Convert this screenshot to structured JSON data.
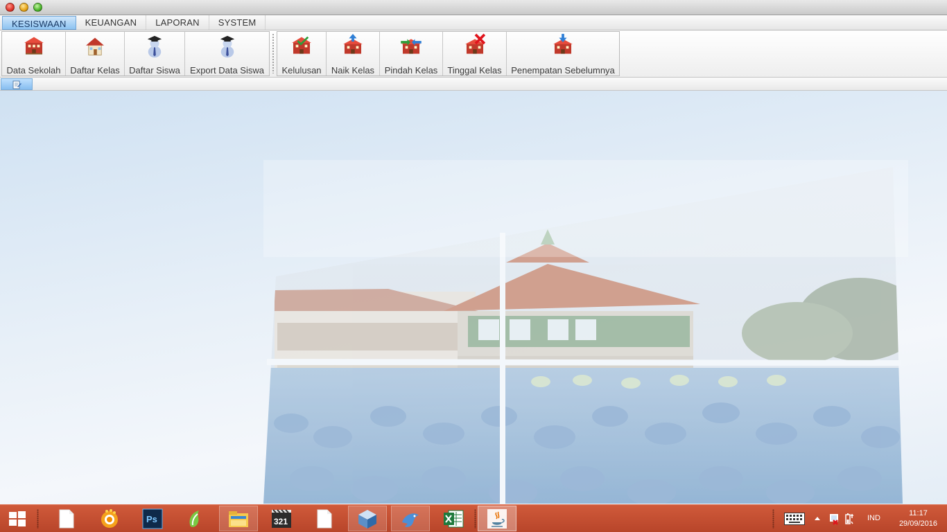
{
  "menubar": {
    "items": [
      {
        "label": "KESISWAAN",
        "active": true
      },
      {
        "label": "KEUANGAN",
        "active": false
      },
      {
        "label": "LAPORAN",
        "active": false
      },
      {
        "label": "SYSTEM",
        "active": false
      }
    ]
  },
  "toolbar": {
    "group1": [
      {
        "label": "Data Sekolah",
        "icon": "school-building-icon"
      },
      {
        "label": "Daftar Kelas",
        "icon": "house-icon"
      },
      {
        "label": "Daftar Siswa",
        "icon": "student-graduate-icon"
      },
      {
        "label": "Export Data Siswa",
        "icon": "student-export-icon"
      }
    ],
    "group2": [
      {
        "label": "Kelulusan",
        "icon": "graduation-building-icon"
      },
      {
        "label": "Naik Kelas",
        "icon": "promote-building-icon"
      },
      {
        "label": "Pindah Kelas",
        "icon": "transfer-building-icon"
      },
      {
        "label": "Tinggal Kelas",
        "icon": "retain-building-icon"
      },
      {
        "label": "Penempatan Sebelumnya",
        "icon": "placement-building-icon"
      }
    ]
  },
  "tabstrip": {
    "icon": "form-tab-icon"
  },
  "taskbar": {
    "start_icon": "windows-logo-icon",
    "apps": [
      {
        "icon": "blank-document-icon",
        "state": "pinned"
      },
      {
        "icon": "browser-orb-icon",
        "state": "pinned"
      },
      {
        "icon": "photoshop-icon",
        "state": "pinned",
        "text": "Ps"
      },
      {
        "icon": "green-app-icon",
        "state": "pinned"
      },
      {
        "icon": "file-explorer-icon",
        "state": "open"
      },
      {
        "icon": "media-player-icon",
        "state": "pinned",
        "text": "321"
      },
      {
        "icon": "blank-document-icon",
        "state": "pinned"
      },
      {
        "icon": "virtualbox-cube-icon",
        "state": "open"
      },
      {
        "icon": "dolphin-icon",
        "state": "open"
      },
      {
        "icon": "excel-icon",
        "state": "pinned"
      },
      {
        "icon": "java-icon",
        "state": "active"
      }
    ],
    "tray": {
      "language": "IND",
      "time": "11:17",
      "date": "29/09/2016",
      "icons": [
        "keyboard-icon",
        "show-hidden-icons-arrow",
        "network-error-icon",
        "battery-icon"
      ]
    }
  },
  "colors": {
    "taskbar": "#c04e30",
    "menu_active": "#8dc3f1",
    "desktop_bg": "#e8f0f8"
  }
}
